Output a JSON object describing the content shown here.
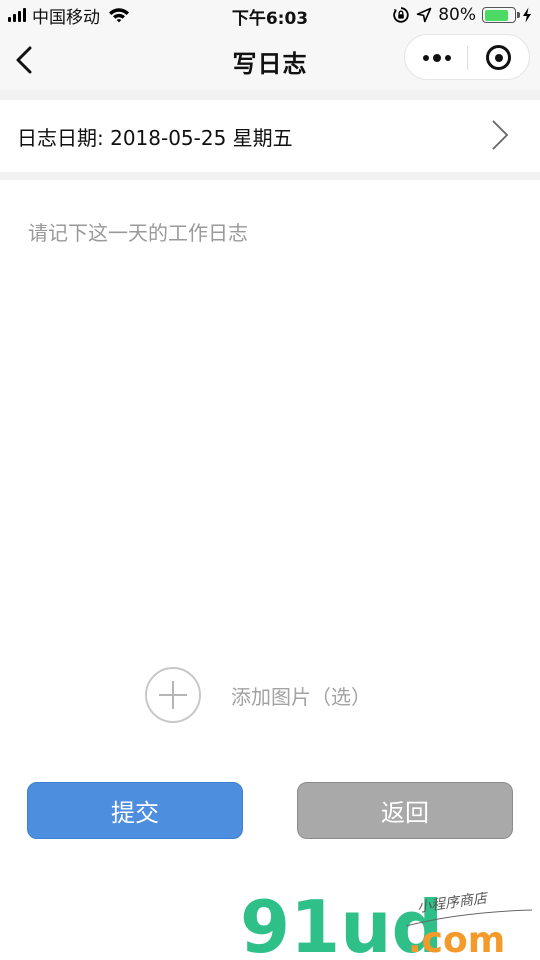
{
  "status_bar": {
    "carrier": "中国移动",
    "time": "下午6:03",
    "battery_percent": "80%",
    "battery_level": 0.8,
    "icons": [
      "signal-icon",
      "wifi-icon",
      "orientation-lock-icon",
      "location-arrow-icon",
      "battery-icon",
      "charging-icon"
    ]
  },
  "nav": {
    "title": "写日志",
    "icons": [
      "back-arrow-icon",
      "more-dots-icon",
      "close-target-icon"
    ]
  },
  "date_row": {
    "text": "日志日期: 2018-05-25 星期五",
    "icon": "chevron-right-icon"
  },
  "log_input": {
    "placeholder": "请记下这一天的工作日志",
    "value": ""
  },
  "add_image": {
    "label": "添加图片（选）",
    "icon": "add-circle-icon"
  },
  "buttons": {
    "submit_label": "提交",
    "return_label": "返回"
  },
  "watermark": {
    "brand": "91ud",
    "domain_suffix": ".com",
    "tagline": "小程序商店"
  },
  "colors": {
    "submit": "#4e8edf",
    "return": "#a9a9a9",
    "battery": "#4cd964",
    "watermark_green": "#2fc08a",
    "watermark_orange": "#f39a2b"
  }
}
